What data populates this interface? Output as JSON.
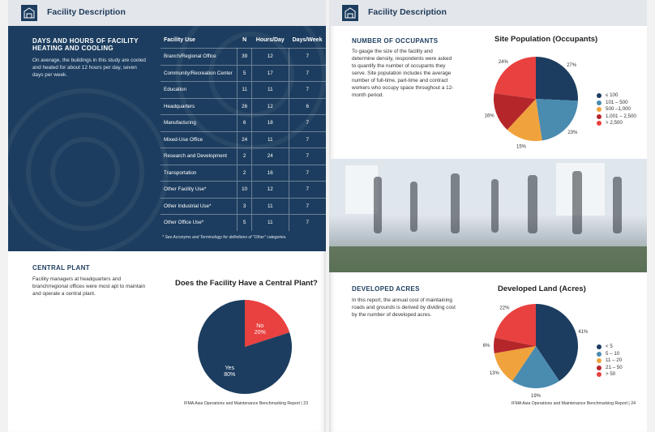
{
  "header": {
    "left_title": "Facility Description",
    "right_title": "Facility Description"
  },
  "hours": {
    "title": "DAYS AND HOURS OF FACILITY HEATING AND COOLING",
    "text": "On average, the buildings in this study are cooled and heated for about 12 hours per day, seven days per week.",
    "columns": [
      "Facility Use",
      "N",
      "Hours/Day",
      "Days/Week"
    ],
    "rows": [
      [
        "Branch/Regional Office",
        "39",
        "12",
        "7"
      ],
      [
        "Community/Recreation Center",
        "5",
        "17",
        "7"
      ],
      [
        "Education",
        "11",
        "11",
        "7"
      ],
      [
        "Headquarters",
        "26",
        "12",
        "6"
      ],
      [
        "Manufacturing",
        "6",
        "18",
        "7"
      ],
      [
        "Mixed-Use Office",
        "24",
        "11",
        "7"
      ],
      [
        "Research and Development",
        "2",
        "24",
        "7"
      ],
      [
        "Transportation",
        "2",
        "16",
        "7"
      ],
      [
        "Other Facility Use*",
        "10",
        "12",
        "7"
      ],
      [
        "Other Industrial Use*",
        "3",
        "11",
        "7"
      ],
      [
        "Other Office Use*",
        "5",
        "11",
        "7"
      ]
    ],
    "footnote": "* See Acronyms and Terminology for definitions of \"Other\" categories."
  },
  "central_plant": {
    "title": "CENTRAL PLANT",
    "text": "Facility managers at headquarters and branch/regional offices were most apt to maintain and operate a central plant."
  },
  "occupants": {
    "title": "NUMBER OF OCCUPANTS",
    "text": "To gauge the size of the facility and determine density, respondents were asked to quantify the number of occupants they serve. Site population includes the average number of full-time, part-time and contract workers who occupy space throughout a 12-month period."
  },
  "developed": {
    "title": "DEVELOPED ACRES",
    "text": "In this report, the annual cost of maintaining roads and grounds is derived by dividing cost by the number of developed acres."
  },
  "footer": {
    "left": "IFMA Asia Operations and Maintenance Benchmarking Report   |   23",
    "right": "IFMA Asia Operations and Maintenance Benchmarking Report   |   24"
  },
  "colors": {
    "navy": "#1c3d5f",
    "red": "#e8413f",
    "blue": "#4a8bb0",
    "orange": "#f0a33c",
    "darkred": "#b5262a"
  },
  "chart_data": [
    {
      "type": "pie",
      "title": "Does the Facility Have a Central Plant?",
      "labels": [
        "No",
        "Yes"
      ],
      "values": [
        20,
        80
      ],
      "value_labels": [
        "20%",
        "80%"
      ],
      "colors": [
        "#e8413f",
        "#1c3d5f"
      ]
    },
    {
      "type": "pie",
      "title": "Site Population (Occupants)",
      "labels": [
        "≤ 100",
        "101 – 500",
        "500 –1,000",
        "1,001 – 2,500",
        "> 2,500"
      ],
      "values": [
        27,
        23,
        15,
        16,
        24
      ],
      "value_labels": [
        "27%",
        "23%",
        "15%",
        "16%",
        "24%"
      ],
      "colors": [
        "#1c3d5f",
        "#4a8bb0",
        "#f0a33c",
        "#b5262a",
        "#e8413f"
      ]
    },
    {
      "type": "pie",
      "title": "Developed Land (Acres)",
      "labels": [
        "< 5",
        "5 – 10",
        "11 – 20",
        "21 – 50",
        "> 50"
      ],
      "values": [
        41,
        19,
        13,
        6,
        22
      ],
      "value_labels": [
        "41%",
        "19%",
        "13%",
        "6%",
        "22%"
      ],
      "colors": [
        "#1c3d5f",
        "#4a8bb0",
        "#f0a33c",
        "#b5262a",
        "#e8413f"
      ]
    }
  ]
}
